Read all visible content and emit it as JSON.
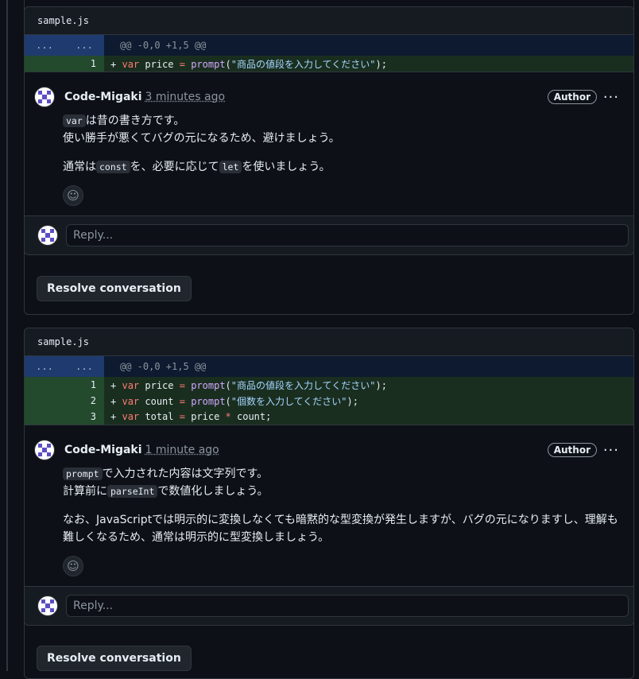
{
  "threads": [
    {
      "filename": "sample.js",
      "hunk": {
        "left": "...",
        "right": "...",
        "header": "@@ -0,0 +1,5 @@"
      },
      "lines": [
        {
          "num": "1",
          "plus": "+",
          "kw": "var",
          "name": " price ",
          "eq": "=",
          "fn": " prompt",
          "open": "(",
          "str": "\"商品の値段を入力してください\"",
          "close": ");"
        }
      ],
      "comment": {
        "author": "Code-Migaki",
        "time": "3 minutes ago",
        "badge": "Author",
        "menu": "···",
        "p1_code": "var",
        "p1_text": "は昔の書き方です。",
        "p2": "使い勝手が悪くてバグの元になるため、避けましょう。",
        "p3_a": "通常は",
        "p3_code1": "const",
        "p3_b": "を、必要に応じて",
        "p3_code2": "let",
        "p3_c": "を使いましょう。",
        "emoji_icon": "☺"
      },
      "reply_placeholder": "Reply...",
      "resolve_label": "Resolve conversation"
    },
    {
      "filename": "sample.js",
      "hunk": {
        "left": "...",
        "right": "...",
        "header": "@@ -0,0 +1,5 @@"
      },
      "lines": [
        {
          "num": "1",
          "plus": "+",
          "kw": "var",
          "name": " price ",
          "eq": "=",
          "fn": " prompt",
          "open": "(",
          "str": "\"商品の値段を入力してください\"",
          "close": ");"
        },
        {
          "num": "2",
          "plus": "+",
          "kw": "var",
          "name": " count ",
          "eq": "=",
          "fn": " prompt",
          "open": "(",
          "str": "\"個数を入力してください\"",
          "close": ");"
        },
        {
          "num": "3",
          "plus": "+",
          "kw": "var",
          "name": " total ",
          "eq": "=",
          "a": " price ",
          "op": "*",
          "b": " count;"
        }
      ],
      "comment": {
        "author": "Code-Migaki",
        "time": "1 minute ago",
        "badge": "Author",
        "menu": "···",
        "p1_code": "prompt",
        "p1_text": "で入力された内容は文字列です。",
        "p2_a": "計算前に",
        "p2_code": "parseInt",
        "p2_b": "で数値化しましょう。",
        "p3_line1": "なお、JavaScriptでは明示的に変換しなくても暗黙的な型変換が発生しますが、バグの元になりますし、理解も",
        "p3_line2": "難しくなるため、通常は明示的に型変換しましょう。",
        "emoji_icon": "☺"
      },
      "reply_placeholder": "Reply...",
      "resolve_label": "Resolve conversation"
    }
  ]
}
